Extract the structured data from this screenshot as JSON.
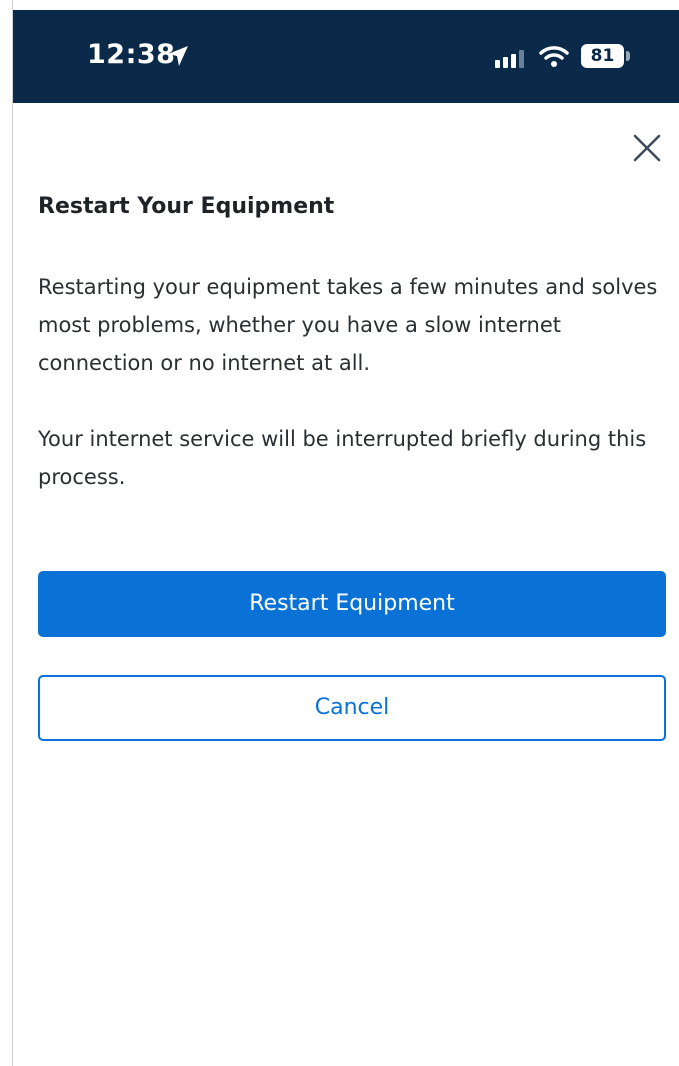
{
  "status_bar": {
    "time": "12:38",
    "battery_level": "81",
    "icons": [
      "location-arrow-icon",
      "cellular-signal-icon",
      "wifi-icon",
      "battery-icon"
    ]
  },
  "dialog": {
    "close_icon": "close-icon",
    "title": "Restart Your Equipment",
    "paragraph_1": "Restarting your equipment takes a few minutes and solves most problems, whether you have a slow internet connection or no internet at all.",
    "paragraph_2": "Your internet service will be interrupted briefly during this process.",
    "primary_button": "Restart Equipment",
    "secondary_button": "Cancel"
  },
  "colors": {
    "status_bar_bg": "#0b2a4a",
    "primary": "#0a72d6",
    "text": "#2b2f33"
  }
}
